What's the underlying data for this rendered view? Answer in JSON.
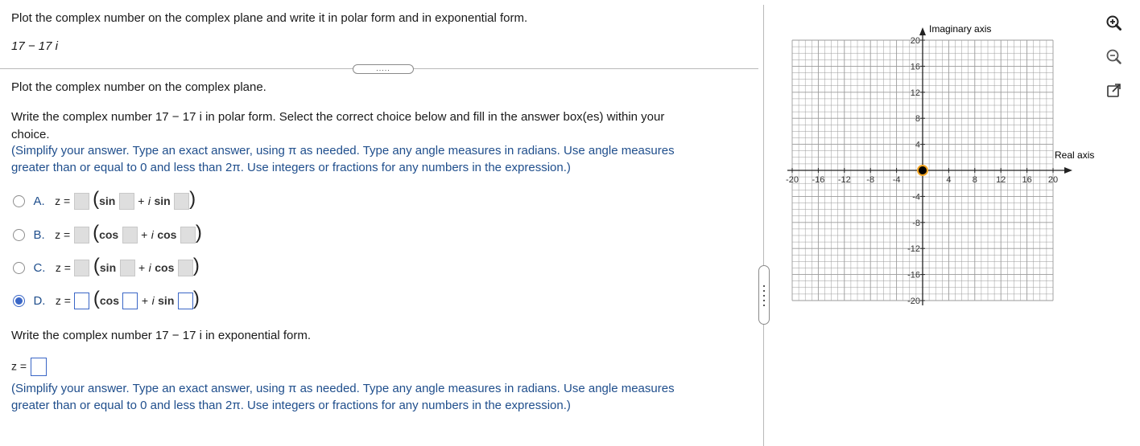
{
  "question": {
    "prompt": "Plot the complex number on the complex plane and write it in polar form and in exponential form.",
    "number": "17 − 17 i"
  },
  "more_button": ".....",
  "part1": {
    "text": "Plot the complex number on the complex plane."
  },
  "part2": {
    "text_line1": "Write the complex number 17 − 17 i in polar form. Select the correct choice below and fill in the answer box(es) within your",
    "text_line2": "choice.",
    "instruction_line1": "(Simplify your answer. Type an exact answer, using π as needed. Type any angle measures in radians. Use angle measures",
    "instruction_line2": "greater than or equal to 0 and less than 2π. Use integers or fractions for any numbers in the expression.)"
  },
  "choices": [
    {
      "letter": "A.",
      "z": "z =",
      "f1": "sin",
      "plus": "+",
      "i": "i",
      "f2": "sin",
      "selected": false
    },
    {
      "letter": "B.",
      "z": "z =",
      "f1": "cos",
      "plus": "+",
      "i": "i",
      "f2": "cos",
      "selected": false
    },
    {
      "letter": "C.",
      "z": "z =",
      "f1": "sin",
      "plus": "+",
      "i": "i",
      "f2": "cos",
      "selected": false
    },
    {
      "letter": "D.",
      "z": "z =",
      "f1": "cos",
      "plus": "+",
      "i": "i",
      "f2": "sin",
      "selected": true
    }
  ],
  "part3": {
    "text": "Write the complex number 17 − 17 i in exponential form.",
    "z": "z =",
    "instruction_line1": "(Simplify your answer. Type an exact answer, using π as needed. Type any angle measures in radians. Use angle measures",
    "instruction_line2": "greater than or equal to 0 and less than 2π. Use integers or fractions for any numbers in the expression.)"
  },
  "graph": {
    "x_axis_label": "Real axis",
    "y_axis_label": "Imaginary axis",
    "x_ticks": [
      "-20",
      "-16",
      "-12",
      "-8",
      "-4",
      "4",
      "8",
      "12",
      "16",
      "20"
    ],
    "y_ticks": [
      "20",
      "16",
      "12",
      "8",
      "4",
      "-4",
      "-8",
      "-12",
      "-16",
      "-20"
    ],
    "range": [
      -20,
      20
    ],
    "tick_step": 4,
    "grid_step": 1,
    "point": {
      "x": 0,
      "y": 0
    },
    "grid_color": "#9a9a9a",
    "point_color": "#000000",
    "point_ring_color": "#f5a623"
  },
  "icons": [
    "zoom-in-icon",
    "zoom-out-icon",
    "popout-icon"
  ]
}
